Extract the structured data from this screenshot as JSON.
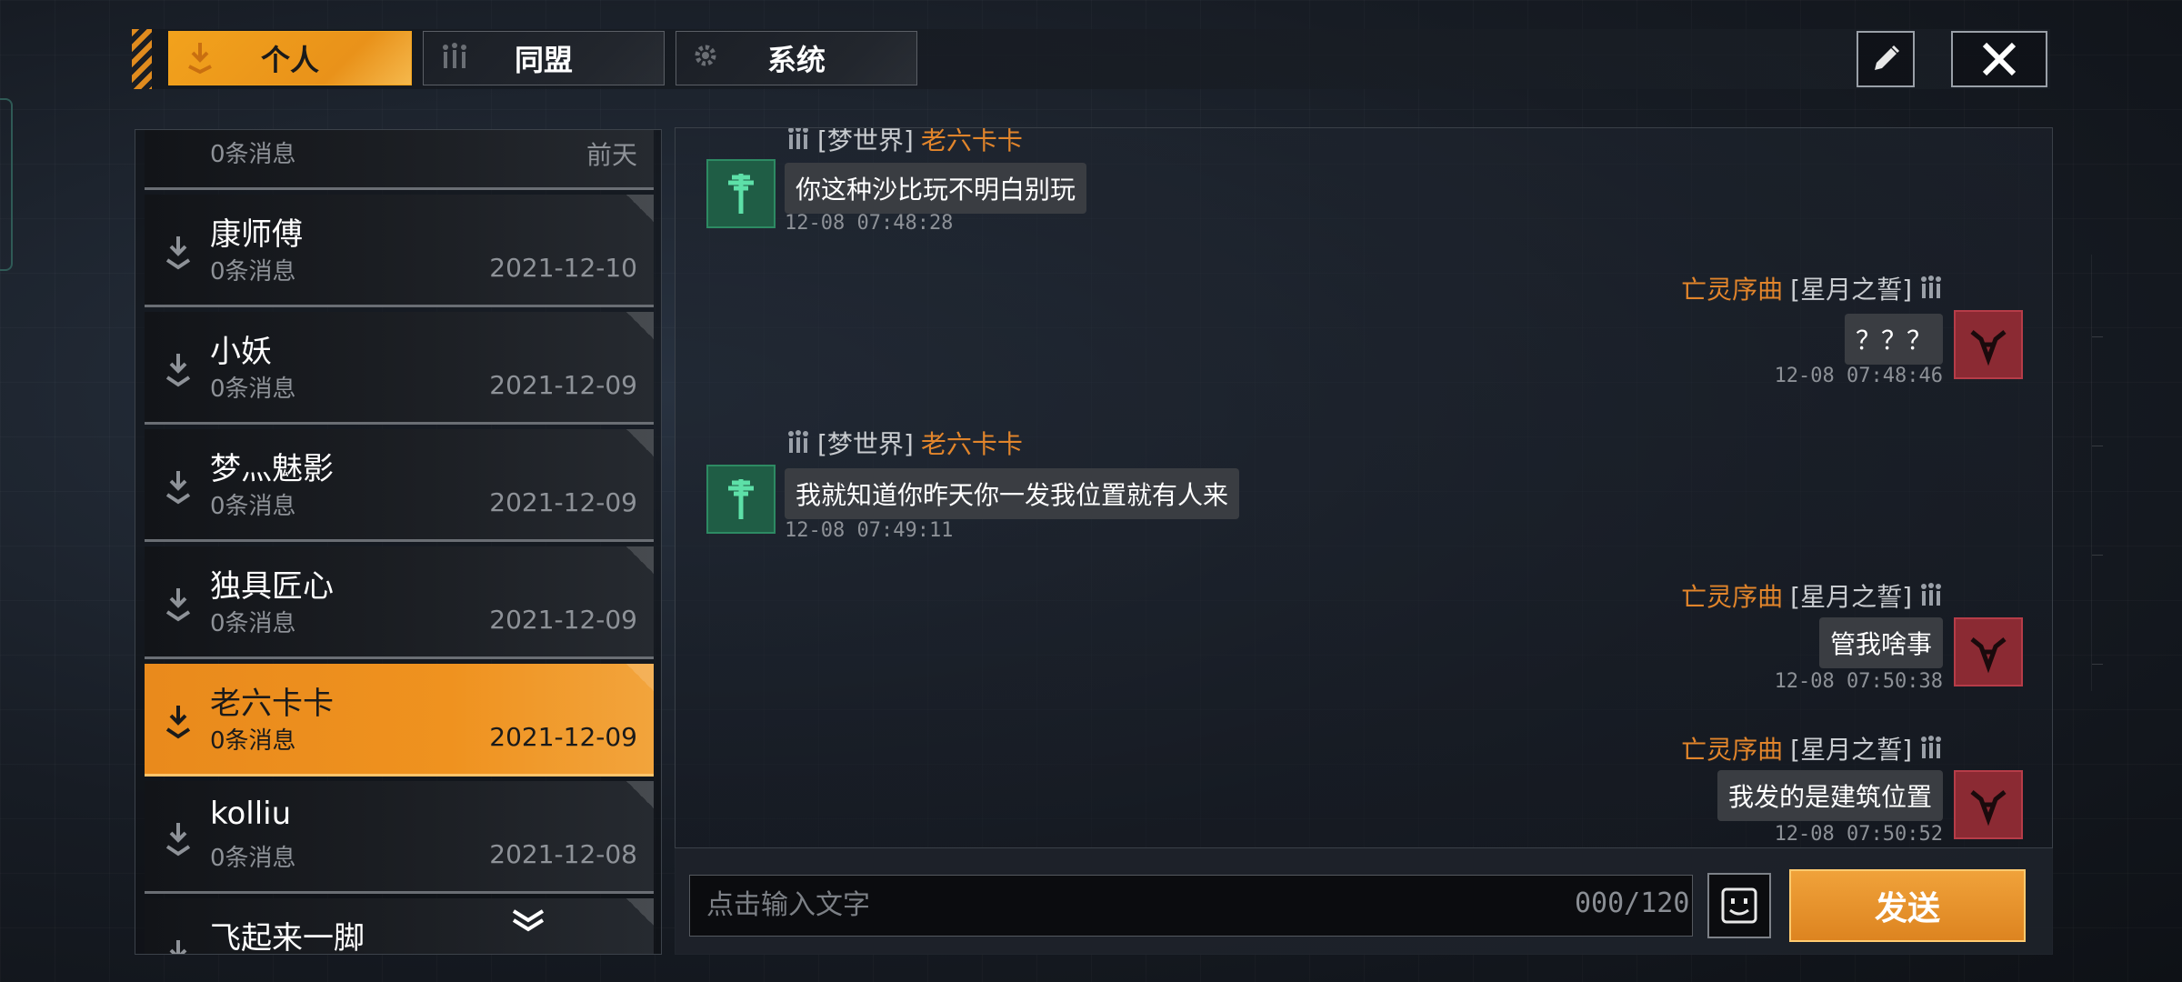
{
  "tabs": {
    "personal": "个人",
    "alliance": "同盟",
    "system": "系统"
  },
  "contacts": [
    {
      "name": "",
      "count": "0条消息",
      "date": "前天"
    },
    {
      "name": "康师傅",
      "count": "0条消息",
      "date": "2021-12-10"
    },
    {
      "name": "小妖",
      "count": "0条消息",
      "date": "2021-12-09"
    },
    {
      "name": "梦灬魅影",
      "count": "0条消息",
      "date": "2021-12-09"
    },
    {
      "name": "独具匠心",
      "count": "0条消息",
      "date": "2021-12-09"
    },
    {
      "name": "老六卡卡",
      "count": "0条消息",
      "date": "2021-12-09",
      "active": true
    },
    {
      "name": "kolliu",
      "count": "0条消息",
      "date": "2021-12-08"
    },
    {
      "name": "飞起来一脚",
      "count": "",
      "date": ""
    }
  ],
  "messages": [
    {
      "side": "left",
      "group": "[梦世界]",
      "name": "老六卡卡",
      "text": "你这种沙比玩不明白别玩",
      "time": "12-08 07:48:28"
    },
    {
      "side": "right",
      "group": "[星月之誓]",
      "name": "亡灵序曲",
      "text": "？？？",
      "time": "12-08 07:48:46"
    },
    {
      "side": "left",
      "group": "[梦世界]",
      "name": "老六卡卡",
      "text": "我就知道你昨天你一发我位置就有人来",
      "time": "12-08 07:49:11"
    },
    {
      "side": "right",
      "group": "[星月之誓]",
      "name": "亡灵序曲",
      "text": "管我啥事",
      "time": "12-08 07:50:38"
    },
    {
      "side": "right",
      "group": "[星月之誓]",
      "name": "亡灵序曲",
      "text": "我发的是建筑位置",
      "time": "12-08 07:50:52"
    }
  ],
  "input": {
    "placeholder": "点击输入文字",
    "counter": "000/120"
  },
  "send_label": "发送",
  "colors": {
    "accent_orange": "#ef921f",
    "sender_name": "#e2852b",
    "avatar_green": "#1f5d45",
    "avatar_red": "#8b2a33"
  },
  "icons": {
    "tab_personal": "download-arrow-icon",
    "tab_alliance": "alliance-icon",
    "tab_system": "gear-icon",
    "edit": "pencil-icon",
    "close": "close-icon",
    "emoji": "smiley-icon",
    "scroll_more": "double-chevron-down-icon"
  }
}
